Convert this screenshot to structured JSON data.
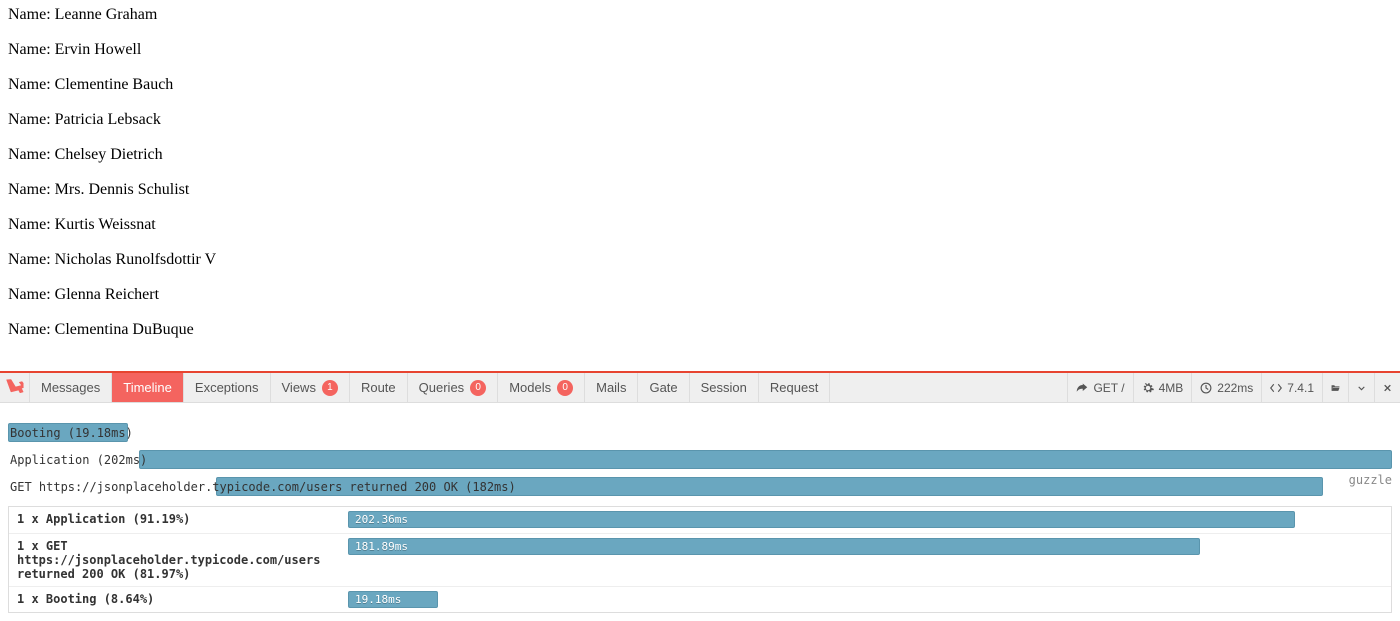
{
  "users": [
    "Leanne Graham",
    "Ervin Howell",
    "Clementine Bauch",
    "Patricia Lebsack",
    "Chelsey Dietrich",
    "Mrs. Dennis Schulist",
    "Kurtis Weissnat",
    "Nicholas Runolfsdottir V",
    "Glenna Reichert",
    "Clementina DuBuque"
  ],
  "name_prefix": "Name: ",
  "debugbar": {
    "tabs": {
      "messages": "Messages",
      "timeline": "Timeline",
      "exceptions": "Exceptions",
      "views": "Views",
      "views_badge": "1",
      "route": "Route",
      "queries": "Queries",
      "queries_badge": "0",
      "models": "Models",
      "models_badge": "0",
      "mails": "Mails",
      "gate": "Gate",
      "session": "Session",
      "request": "Request"
    },
    "right": {
      "method_path": "GET /",
      "memory": "4MB",
      "time": "222ms",
      "php": "7.4.1"
    }
  },
  "timeline": {
    "rows": {
      "booting_label": "Booting (19.18ms)",
      "application_label": "Application (202ms)",
      "get_label": "GET https://jsonplaceholder.typicode.com/users returned 200 OK (182ms)",
      "guzzle_tag": "guzzle"
    },
    "measures": {
      "app": {
        "label": "1 x Application (91.19%)",
        "value": "202.36ms",
        "width_pct": 91.19
      },
      "get": {
        "label": "1 x GET https://jsonplaceholder.typicode.com/users returned 200 OK (81.97%)",
        "value": "181.89ms",
        "width_pct": 81.97
      },
      "boot": {
        "label": "1 x Booting (8.64%)",
        "value": "19.18ms",
        "width_pct": 8.64
      }
    }
  }
}
